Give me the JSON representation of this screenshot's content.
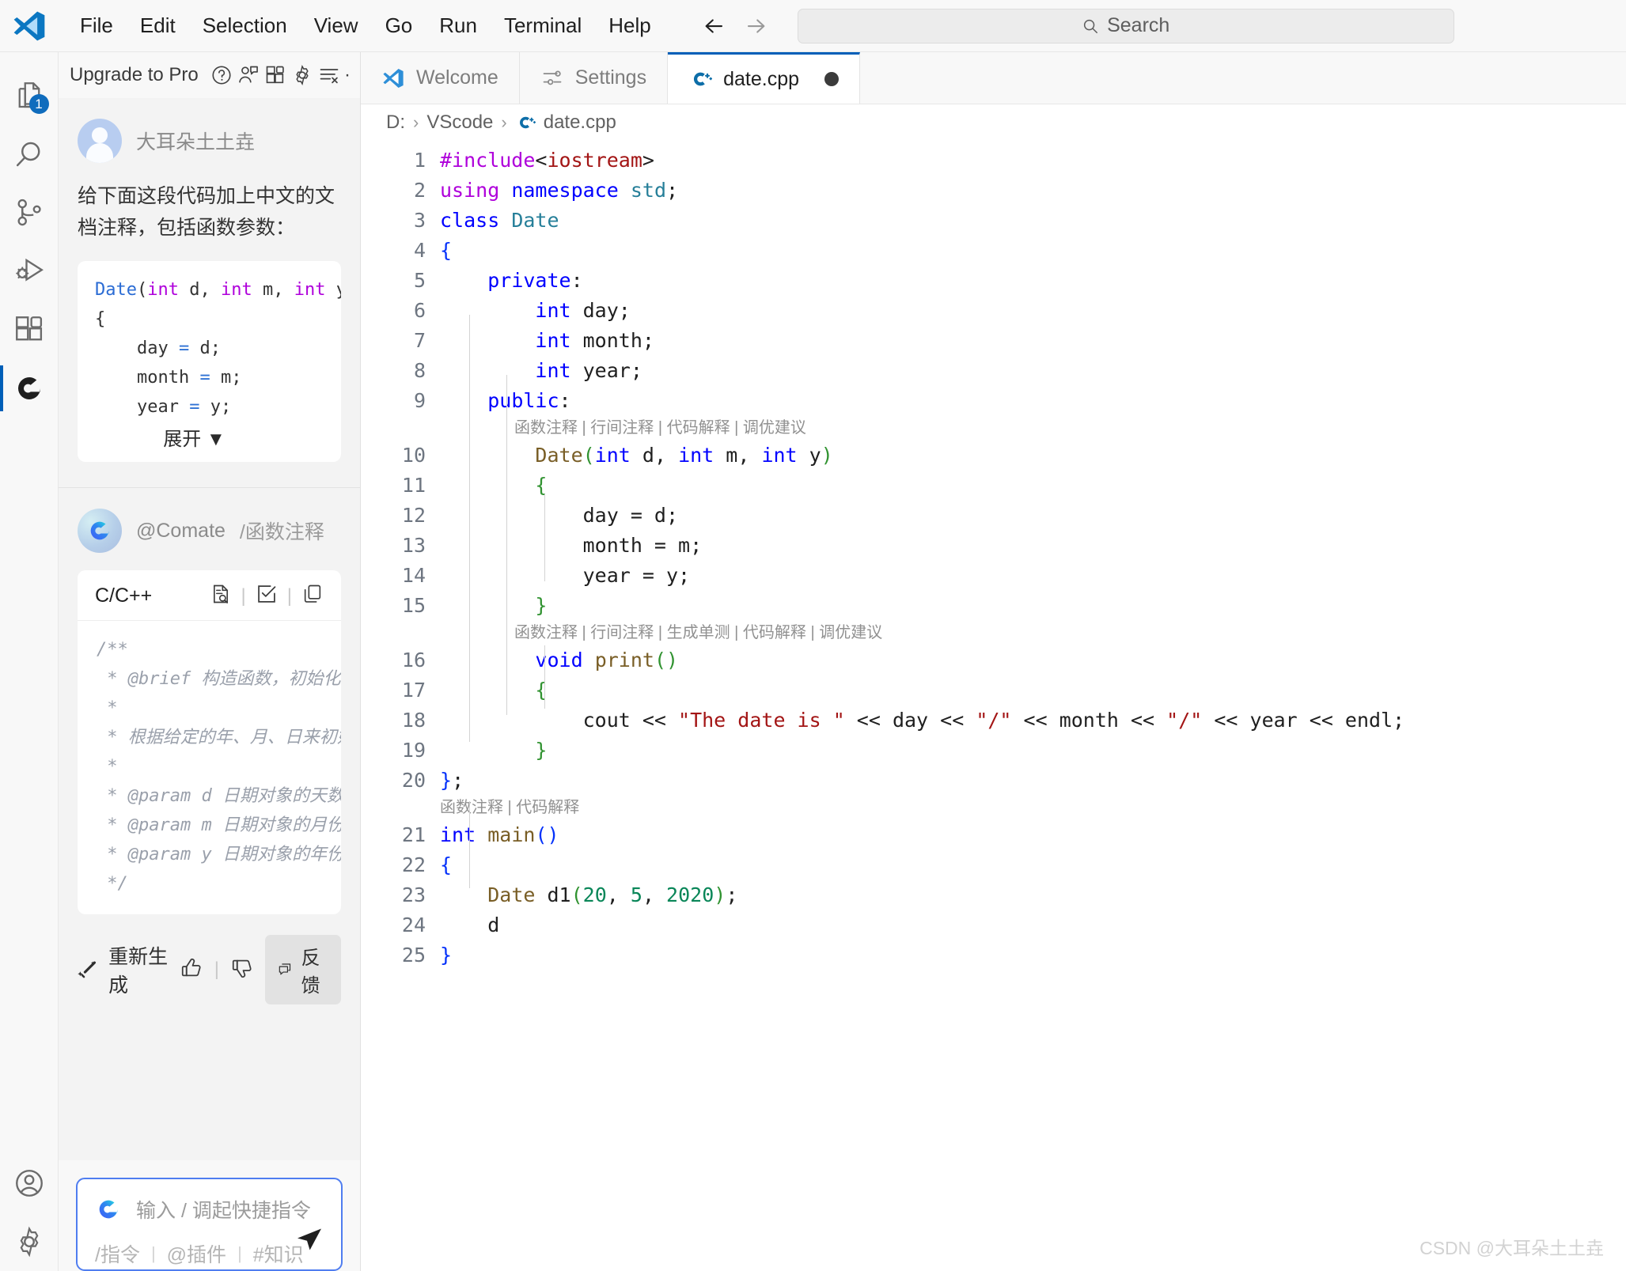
{
  "window": {
    "menu": [
      "File",
      "Edit",
      "Selection",
      "View",
      "Go",
      "Run",
      "Terminal",
      "Help"
    ],
    "search_placeholder": "Search",
    "back_icon": "arrow-left-icon",
    "forward_icon": "arrow-right-icon"
  },
  "activitybar": {
    "items": [
      {
        "name": "explorer",
        "icon": "files-icon",
        "badge": "1"
      },
      {
        "name": "search",
        "icon": "search-icon",
        "badge": ""
      },
      {
        "name": "source-control",
        "icon": "source-control-icon",
        "badge": ""
      },
      {
        "name": "run-and-debug",
        "icon": "debug-icon",
        "badge": ""
      },
      {
        "name": "extensions",
        "icon": "extensions-icon",
        "badge": ""
      },
      {
        "name": "comate",
        "icon": "comate-icon",
        "badge": ""
      }
    ],
    "bottom": [
      {
        "name": "accounts",
        "icon": "account-icon"
      },
      {
        "name": "manage",
        "icon": "gear-icon"
      }
    ]
  },
  "panel": {
    "toolbar": {
      "upgrade_label": "Upgrade to Pro",
      "help_icon": "question-circle-icon",
      "account_icon": "person-add-icon",
      "layout_icon": "panel-layout-icon",
      "settings_icon": "gear-icon",
      "clear_icon": "clear-list-icon",
      "more_icon": "more-dots-icon"
    },
    "user": {
      "name": "大耳朵土土垚",
      "prompt": "给下面这段代码加上中文的文档注释，包括函数参数：",
      "code_lines": [
        "Date(int d, int m, int y)",
        "{",
        "    day = d;",
        "    month = m;",
        "    year = y;"
      ],
      "expand_label": "展开",
      "expand_icon": "chevron-down-icon"
    },
    "assistant": {
      "name": "@Comate",
      "command": "/函数注释",
      "language": "C/C++",
      "actions": {
        "diff_icon": "file-search-icon",
        "apply_icon": "check-box-icon",
        "copy_icon": "copy-icon"
      },
      "answer_lines": [
        "/**",
        " * @brief 构造函数，初始化日期对象",
        " *",
        " * 根据给定的年、月、日来初始化日期",
        " *",
        " * @param d 日期对象的天数",
        " * @param m 日期对象的月份",
        " * @param y 日期对象的年份",
        " */"
      ],
      "regenerate_label": "重新生成",
      "regenerate_icon": "magic-wand-icon",
      "thumbs_up_icon": "thumbs-up-icon",
      "thumbs_down_icon": "thumbs-down-icon",
      "feedback_label": "反馈",
      "feedback_icon": "comment-icon"
    },
    "input": {
      "logo_icon": "comate-logo-icon",
      "placeholder": "输入 / 调起快捷指令",
      "hint_command": "/指令",
      "hint_plugin": "@插件",
      "hint_knowledge": "#知识",
      "send_icon": "send-icon"
    }
  },
  "editor": {
    "tabs": [
      {
        "label": "Welcome",
        "icon": "vscode-icon",
        "active": false,
        "dirty": false
      },
      {
        "label": "Settings",
        "icon": "settings-icon",
        "active": false,
        "dirty": false
      },
      {
        "label": "date.cpp",
        "icon": "cpp-icon",
        "active": true,
        "dirty": true
      }
    ],
    "breadcrumb": {
      "drive": "D:",
      "folder": "VScode",
      "file": "date.cpp",
      "file_icon": "cpp-icon",
      "separator": "›"
    },
    "codelens": {
      "ctor": "函数注释 | 行间注释 | 代码解释 | 调优建议",
      "print": "函数注释 | 行间注释 | 生成单测 | 代码解释 | 调优建议",
      "main": "函数注释 | 代码解释"
    },
    "lines": [
      {
        "n": "1",
        "code": "#include<iostream>"
      },
      {
        "n": "2",
        "code": "using namespace std;"
      },
      {
        "n": "3",
        "code": "class Date"
      },
      {
        "n": "4",
        "code": "{"
      },
      {
        "n": "5",
        "code": "    private:"
      },
      {
        "n": "6",
        "code": "        int day;"
      },
      {
        "n": "7",
        "code": "        int month;"
      },
      {
        "n": "8",
        "code": "        int year;"
      },
      {
        "n": "9",
        "code": "    public:"
      },
      {
        "n": "10",
        "code": "        Date(int d, int m, int y)"
      },
      {
        "n": "11",
        "code": "        {"
      },
      {
        "n": "12",
        "code": "            day = d;"
      },
      {
        "n": "13",
        "code": "            month = m;"
      },
      {
        "n": "14",
        "code": "            year = y;"
      },
      {
        "n": "15",
        "code": "        }"
      },
      {
        "n": "16",
        "code": "        void print()"
      },
      {
        "n": "17",
        "code": "        {"
      },
      {
        "n": "18",
        "code": "            cout << \"The date is \" << day << \"/\" << month << \"/\" << year << endl;"
      },
      {
        "n": "19",
        "code": "        }"
      },
      {
        "n": "20",
        "code": "};"
      },
      {
        "n": "21",
        "code": "int main()"
      },
      {
        "n": "22",
        "code": "{"
      },
      {
        "n": "23",
        "code": "    Date d1(20, 5, 2020);"
      },
      {
        "n": "24",
        "code": "    d"
      },
      {
        "n": "25",
        "code": "}"
      }
    ],
    "watermark": "CSDN @大耳朵土土垚"
  },
  "colors": {
    "accent": "#005fb8",
    "badge": "#0f6cbd",
    "input_border": "#4f7df0",
    "keyword": "#0000ff",
    "preprocessor": "#af00db",
    "string": "#a31515",
    "type": "#267f99",
    "function": "#795e26",
    "number": "#098658"
  }
}
